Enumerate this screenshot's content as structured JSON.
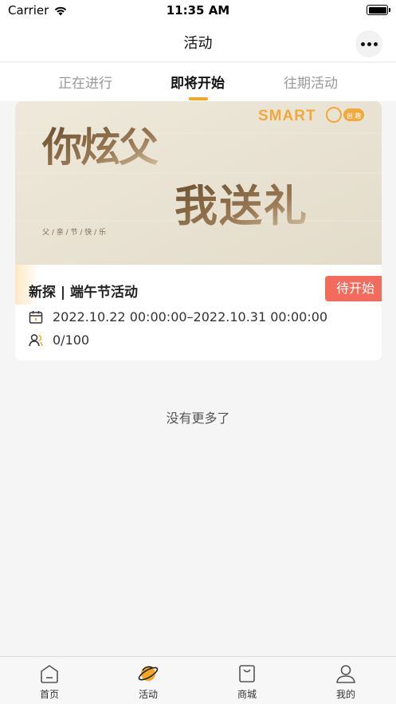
{
  "status_bar": {
    "carrier": "Carrier",
    "time": "11:35 AM"
  },
  "nav": {
    "title": "活动"
  },
  "tabs": [
    {
      "label": "正在进行",
      "active": false
    },
    {
      "label": "即将开始",
      "active": true
    },
    {
      "label": "往期活动",
      "active": false
    }
  ],
  "accent_color": "#f6a623",
  "activity": {
    "banner": {
      "brand": "SMART",
      "brand_badge": "创 趣",
      "headline_1": "你炫父",
      "headline_2": "我送礼",
      "subtitle": "父 / 亲 / 节 / 快 / 乐"
    },
    "title": "新探 | 端午节活动",
    "status": "待开始",
    "date_range": "2022.10.22 00:00:00–2022.10.31 00:00:00",
    "participants": "0/100"
  },
  "list_end_text": "没有更多了",
  "tabbar": [
    {
      "label": "首页",
      "icon": "home-icon"
    },
    {
      "label": "活动",
      "icon": "planet-icon",
      "active": true
    },
    {
      "label": "商城",
      "icon": "shopping-bag-icon"
    },
    {
      "label": "我的",
      "icon": "user-icon"
    }
  ]
}
